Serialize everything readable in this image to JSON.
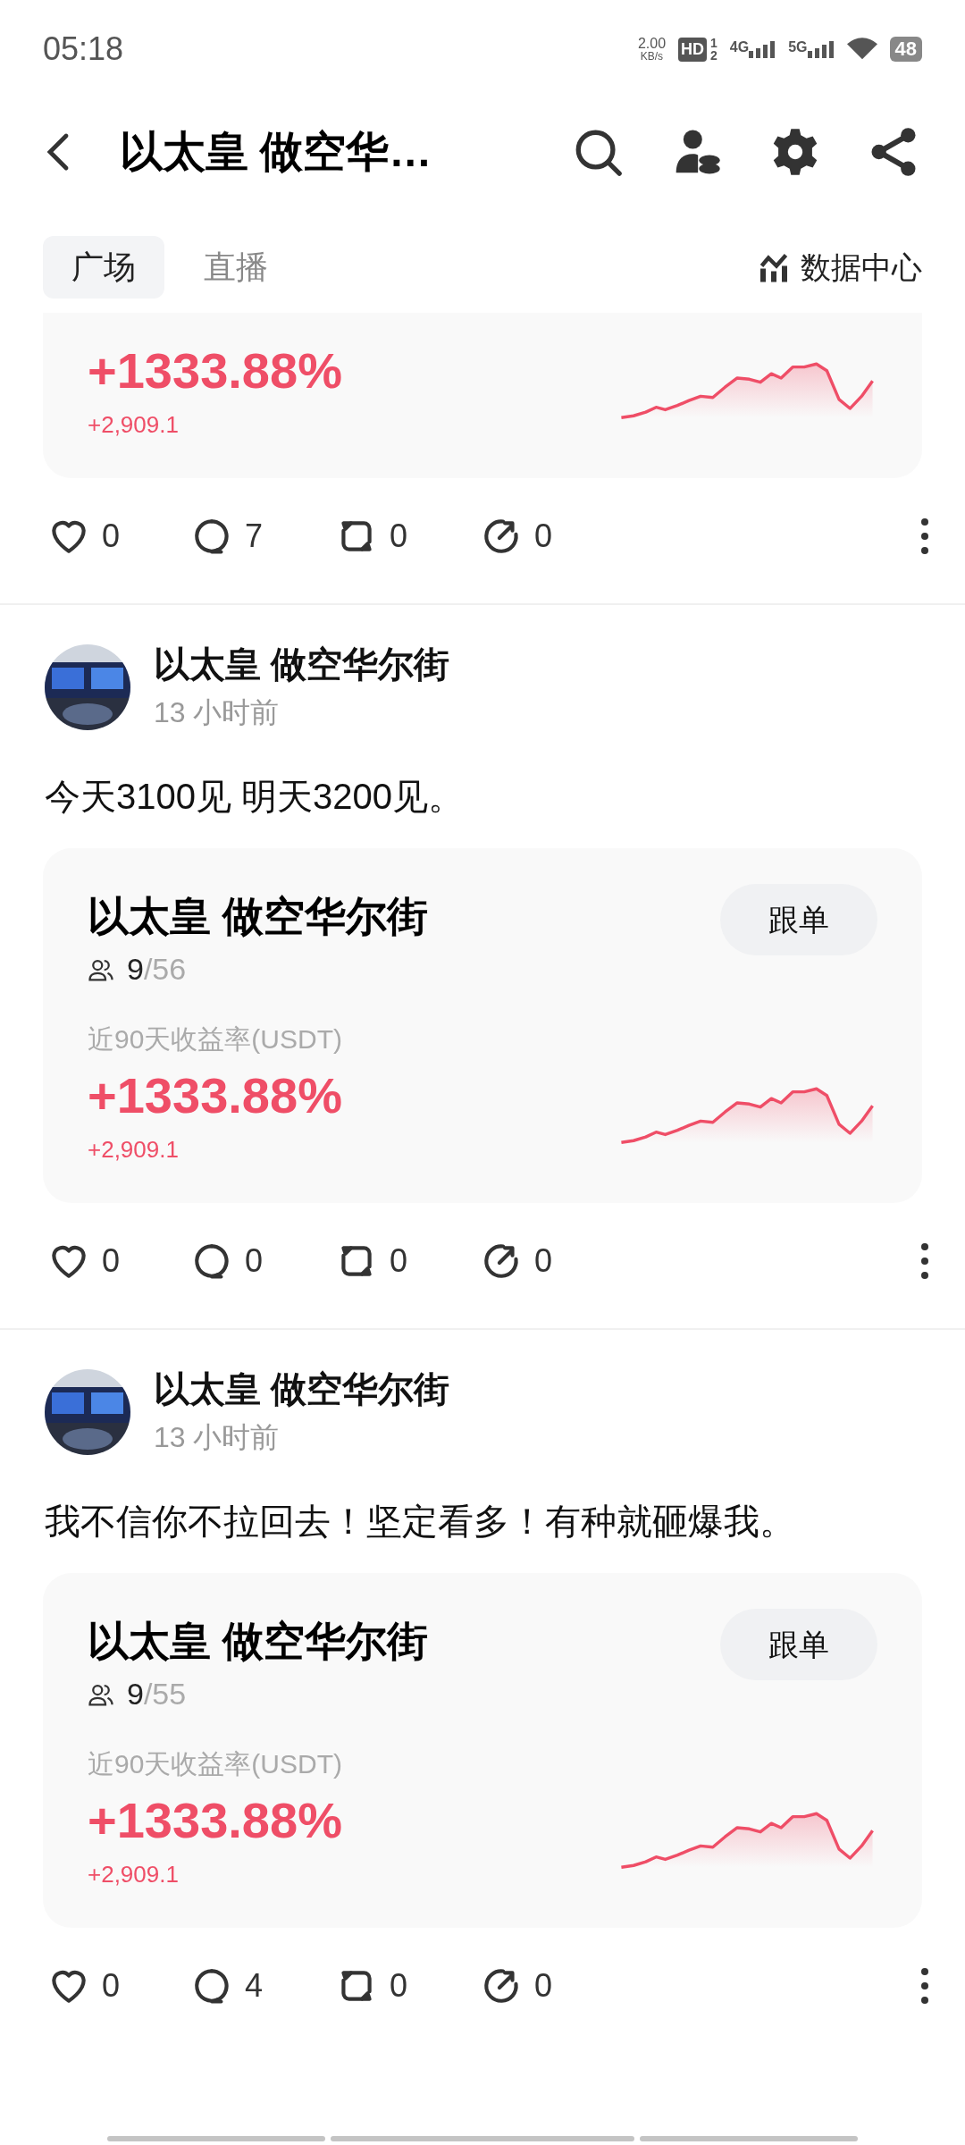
{
  "status_bar": {
    "time": "05:18",
    "speed": "2.00",
    "speed_unit": "KB/s",
    "hd": "HD",
    "hd_sim": "1",
    "hd_sim2": "2",
    "net1": "4G",
    "net2": "5G",
    "battery": "48"
  },
  "header": {
    "title": "以太皇 做空华…"
  },
  "tabs": [
    {
      "label": "广场",
      "selected": true
    },
    {
      "label": "直播",
      "selected": false
    }
  ],
  "data_center": "数据中心",
  "posts": [
    {
      "card": {
        "return": "+1333.88%",
        "change": "+2,909.1"
      },
      "actions": {
        "likes": "0",
        "comments": "7",
        "reposts": "0",
        "shares": "0"
      }
    },
    {
      "author": "以太皇 做空华尔街",
      "time": "13 小时前",
      "text": "今天3100见 明天3200见。",
      "card": {
        "title": "以太皇 做空华尔街",
        "button": "跟单",
        "followers": "9",
        "capacity": "/56",
        "return_label": "近90天收益率(USDT)",
        "return": "+1333.88%",
        "change": "+2,909.1"
      },
      "actions": {
        "likes": "0",
        "comments": "0",
        "reposts": "0",
        "shares": "0"
      }
    },
    {
      "author": "以太皇 做空华尔街",
      "time": "13 小时前",
      "text": "我不信你不拉回去！坚定看多！有种就砸爆我。",
      "card": {
        "title": "以太皇 做空华尔街",
        "button": "跟单",
        "followers": "9",
        "capacity": "/55",
        "return_label": "近90天收益率(USDT)",
        "return": "+1333.88%",
        "change": "+2,909.1"
      },
      "actions": {
        "likes": "0",
        "comments": "4",
        "reposts": "0",
        "shares": "0"
      }
    }
  ]
}
